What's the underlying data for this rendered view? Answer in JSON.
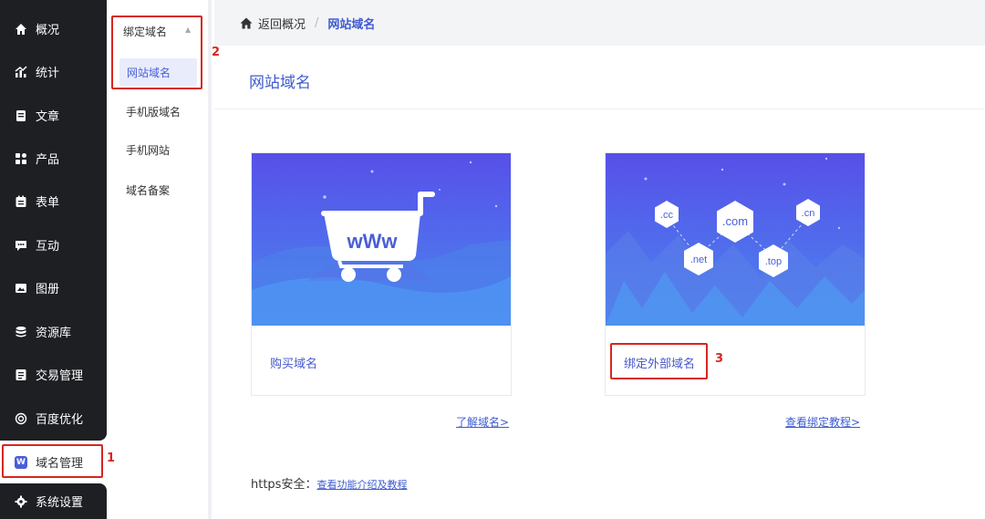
{
  "nav": {
    "items": [
      {
        "label": "概况",
        "icon": "home-icon"
      },
      {
        "label": "统计",
        "icon": "stats-icon"
      },
      {
        "label": "文章",
        "icon": "article-icon"
      },
      {
        "label": "产品",
        "icon": "product-icon"
      },
      {
        "label": "表单",
        "icon": "form-icon"
      },
      {
        "label": "互动",
        "icon": "chat-icon"
      },
      {
        "label": "图册",
        "icon": "album-icon"
      },
      {
        "label": "资源库",
        "icon": "database-icon"
      },
      {
        "label": "交易管理",
        "icon": "trade-icon"
      },
      {
        "label": "百度优化",
        "icon": "seo-icon"
      },
      {
        "label": "域名管理",
        "icon": "domain-icon",
        "badge": "W"
      },
      {
        "label": "系统设置",
        "icon": "gear-icon"
      }
    ],
    "active_color": "#4a5fd6"
  },
  "subnav": {
    "group_label": "绑定域名",
    "active_item": "网站域名",
    "items": [
      "手机版域名",
      "手机网站",
      "域名备案"
    ]
  },
  "breadcrumb": {
    "back_label": "返回概况",
    "separator": "/",
    "current": "网站域名"
  },
  "main": {
    "title": "网站域名",
    "cards": [
      {
        "label": "购买域名",
        "link": "了解域名>"
      },
      {
        "label": "绑定外部域名",
        "link": "查看绑定教程>"
      }
    ],
    "domain_tags": [
      ".cc",
      ".com",
      ".cn",
      ".net",
      ".top"
    ],
    "cart_text": "wWw",
    "https_label": "https安全：",
    "https_link": "查看功能介绍及教程"
  },
  "annotations": [
    "1",
    "2",
    "3"
  ]
}
